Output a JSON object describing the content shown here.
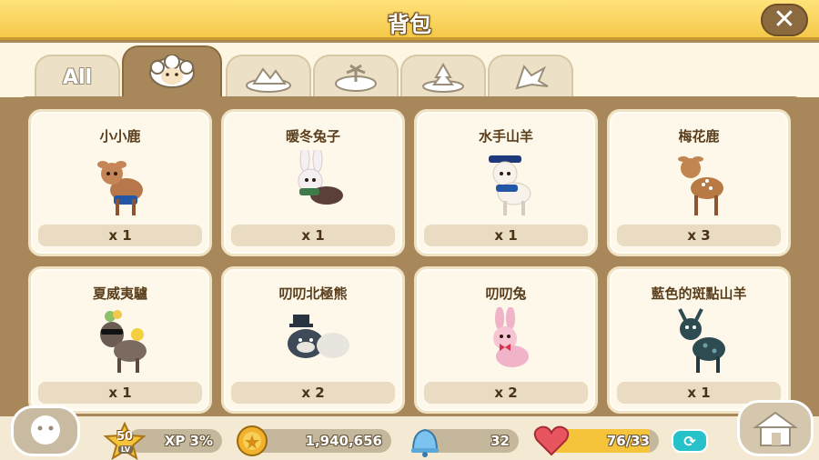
{
  "window": {
    "title": "背包"
  },
  "tabs": [
    {
      "label": "All",
      "icon": "all-text"
    },
    {
      "label": "",
      "icon": "sheep-icon",
      "active": true
    },
    {
      "label": "",
      "icon": "landscape-icon"
    },
    {
      "label": "",
      "icon": "island-icon"
    },
    {
      "label": "",
      "icon": "trees-icon"
    },
    {
      "label": "",
      "icon": "leaf-icon"
    }
  ],
  "items": [
    {
      "name": "小小鹿",
      "count": "x 1",
      "color": "#b8774a"
    },
    {
      "name": "暖冬兔子",
      "count": "x 1",
      "color": "#e9e0e4"
    },
    {
      "name": "水手山羊",
      "count": "x 1",
      "color": "#f3eee8"
    },
    {
      "name": "梅花鹿",
      "count": "x 3",
      "color": "#b87a44"
    },
    {
      "name": "夏威夷驢",
      "count": "x 1",
      "color": "#6a5b53"
    },
    {
      "name": "叨叨北極熊",
      "count": "x 2",
      "color": "#3e4a57"
    },
    {
      "name": "叨叨兔",
      "count": "x 2",
      "color": "#f1b3c7"
    },
    {
      "name": "藍色的斑點山羊",
      "count": "x 1",
      "color": "#2f4b52"
    }
  ],
  "hud": {
    "level": "50",
    "level_tag": "LV",
    "xp": "XP 3%",
    "coins": "1,940,656",
    "bells": "32",
    "hearts": "76/33"
  },
  "colors": {
    "title_bar": "#f5c94a",
    "panel": "#a8875a",
    "card": "#fdf8ea",
    "heart": "#e8555e",
    "refresh": "#27c1c9"
  }
}
